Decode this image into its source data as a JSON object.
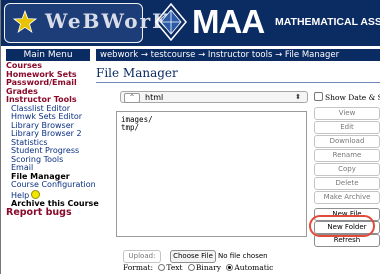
{
  "header": {
    "webwork_logo": "WeBWorK",
    "maa_logo": "MAA",
    "maa_name": "MATHEMATICAL ASSOCIATION OF AMERICA"
  },
  "menu": {
    "title": "Main Menu",
    "courses": "Courses",
    "homework_sets": "Homework Sets",
    "password_email": "Password/Email",
    "grades": "Grades",
    "instructor_tools": "Instructor Tools",
    "items": [
      "Classlist Editor",
      "Hmwk Sets Editor",
      "Library Browser",
      "Library Browser 2",
      "Statistics",
      "Student Progress",
      "Scoring Tools",
      "Email",
      "File Manager",
      "Course Configuration"
    ],
    "help": "Help",
    "archive": "Archive this Course",
    "report_bugs": "Report bugs"
  },
  "breadcrumb": "webwork → testcourse → Instructor tools → File Manager",
  "page_title": "File Manager",
  "directory": {
    "up_symbol": "^",
    "value": "html",
    "arrow": "⬍"
  },
  "files": [
    "images/",
    "tmp/"
  ],
  "show_date_label": "Show Date & Size",
  "actions": {
    "view": "View",
    "edit": "Edit",
    "download": "Download",
    "rename": "Rename",
    "copy": "Copy",
    "delete": "Delete",
    "make_archive": "Make Archive",
    "new_file": "New File",
    "new_folder": "New Folder",
    "refresh": "Refresh"
  },
  "upload": {
    "upload_button": "Upload:",
    "choose_button": "Choose File",
    "no_file": "No file chosen",
    "format_label": "Format:",
    "format_options": [
      "Text",
      "Binary",
      "Automatic"
    ],
    "selected_format": "Automatic"
  },
  "colors": {
    "header_bg": "#0b2b63",
    "menu_item": "#8a0a2a",
    "menu_sub": "#0a2f80",
    "highlight": "#e24a3a"
  }
}
